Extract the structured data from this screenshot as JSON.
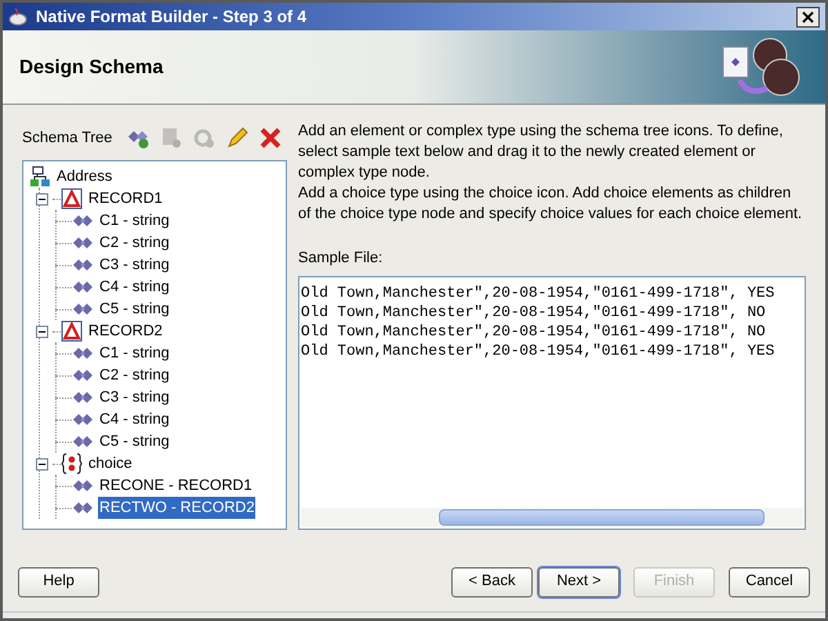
{
  "window": {
    "title": "Native Format Builder - Step 3 of 4"
  },
  "header": {
    "title": "Design Schema"
  },
  "schema_tree": {
    "label": "Schema Tree",
    "toolbar": [
      {
        "kind": "add",
        "disabled": false
      },
      {
        "kind": "document",
        "disabled": true
      },
      {
        "kind": "gear",
        "disabled": true
      },
      {
        "kind": "edit",
        "disabled": false
      },
      {
        "kind": "delete",
        "disabled": false
      }
    ],
    "nodes": [
      {
        "label": "Address",
        "kind": "root",
        "selected": false,
        "children": [
          {
            "label": "RECORD1",
            "kind": "record",
            "expanded": true,
            "selected": false,
            "children": [
              {
                "label": "C1 - string",
                "kind": "element",
                "selected": false
              },
              {
                "label": "C2 - string",
                "kind": "element",
                "selected": false
              },
              {
                "label": "C3 - string",
                "kind": "element",
                "selected": false
              },
              {
                "label": "C4 - string",
                "kind": "element",
                "selected": false
              },
              {
                "label": "C5 - string",
                "kind": "element",
                "selected": false
              }
            ]
          },
          {
            "label": "RECORD2",
            "kind": "record",
            "expanded": true,
            "selected": false,
            "children": [
              {
                "label": "C1 - string",
                "kind": "element",
                "selected": false
              },
              {
                "label": "C2 - string",
                "kind": "element",
                "selected": false
              },
              {
                "label": "C3 - string",
                "kind": "element",
                "selected": false
              },
              {
                "label": "C4 - string",
                "kind": "element",
                "selected": false
              },
              {
                "label": "C5 - string",
                "kind": "element",
                "selected": false
              }
            ]
          },
          {
            "label": "choice",
            "kind": "choice",
            "expanded": true,
            "selected": false,
            "children": [
              {
                "label": "RECONE - RECORD1",
                "kind": "element",
                "selected": false
              },
              {
                "label": "RECTWO - RECORD2",
                "kind": "element",
                "selected": true
              }
            ]
          }
        ]
      }
    ]
  },
  "instructions": [
    "Add an element or complex type using the schema tree icons. To define, select sample text below and drag it to the newly created element or complex type node.",
    "Add a choice type using the choice icon. Add choice elements as children of the choice type node and specify choice values for each choice element."
  ],
  "sample_file": {
    "label": "Sample File:",
    "lines": [
      "Old Town,Manchester\",20-08-1954,\"0161-499-1718\", YES",
      "Old Town,Manchester\",20-08-1954,\"0161-499-1718\", NO",
      "Old Town,Manchester\",20-08-1954,\"0161-499-1718\", NO",
      "Old Town,Manchester\",20-08-1954,\"0161-499-1718\", YES"
    ]
  },
  "buttons": [
    {
      "label": "Help",
      "kind": "help",
      "disabled": false,
      "focused": false
    },
    {
      "label": "< Back",
      "kind": "back",
      "disabled": false,
      "focused": false
    },
    {
      "label": "Next >",
      "kind": "next",
      "disabled": false,
      "focused": true
    },
    {
      "label": "Finish",
      "kind": "finish",
      "disabled": true,
      "focused": false
    },
    {
      "label": "Cancel",
      "kind": "cancel",
      "disabled": false,
      "focused": false
    }
  ]
}
